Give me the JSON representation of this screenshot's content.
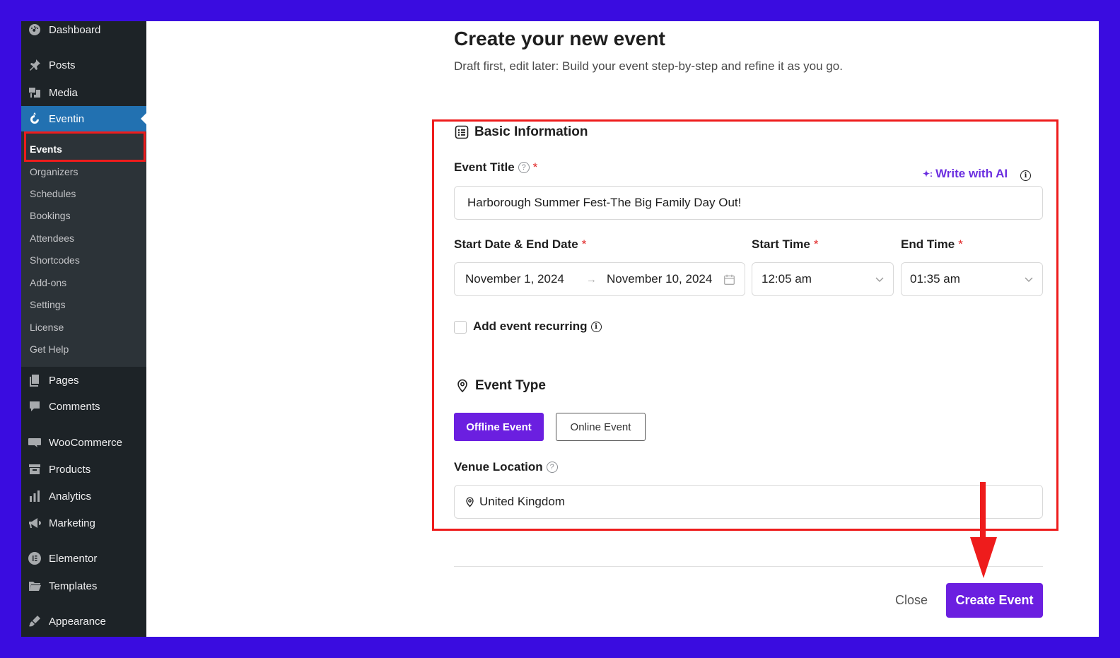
{
  "sidebar": {
    "items": [
      {
        "label": "Dashboard",
        "icon": "dashboard-icon"
      },
      {
        "label": "Posts",
        "icon": "pin-icon"
      },
      {
        "label": "Media",
        "icon": "media-icon"
      },
      {
        "label": "Eventin",
        "icon": "eventin-icon"
      },
      {
        "label": "Pages",
        "icon": "pages-icon"
      },
      {
        "label": "Comments",
        "icon": "comments-icon"
      },
      {
        "label": "WooCommerce",
        "icon": "woo-icon"
      },
      {
        "label": "Products",
        "icon": "products-icon"
      },
      {
        "label": "Analytics",
        "icon": "analytics-icon"
      },
      {
        "label": "Marketing",
        "icon": "marketing-icon"
      },
      {
        "label": "Elementor",
        "icon": "elementor-icon"
      },
      {
        "label": "Templates",
        "icon": "folder-icon"
      },
      {
        "label": "Appearance",
        "icon": "brush-icon"
      }
    ],
    "submenu": [
      "Events",
      "Organizers",
      "Schedules",
      "Bookings",
      "Attendees",
      "Shortcodes",
      "Add-ons",
      "Settings",
      "License",
      "Get Help"
    ]
  },
  "header": {
    "title": "Create your new event",
    "subtitle": "Draft first, edit later: Build your event step-by-step and refine it as you go."
  },
  "basic": {
    "section_title": "Basic Information",
    "event_title_label": "Event Title",
    "required_mark": "*",
    "write_ai": "Write with AI",
    "event_title_value": "Harborough Summer Fest-The Big Family Day Out!",
    "date_label": "Start Date & End Date",
    "start_time_label": "Start Time",
    "end_time_label": "End Time",
    "start_date": "November 1, 2024",
    "end_date": "November 10, 2024",
    "start_time": "12:05 am",
    "end_time": "01:35 am",
    "recurring_label": "Add event recurring"
  },
  "event_type": {
    "section_title": "Event Type",
    "offline": "Offline Event",
    "online": "Online Event",
    "venue_label": "Venue Location",
    "venue_value": "United Kingdom"
  },
  "footer": {
    "close": "Close",
    "create": "Create Event"
  },
  "colors": {
    "accent": "#6b1fe0",
    "highlight": "#ee1c1c",
    "background": "#3a0ce0"
  }
}
